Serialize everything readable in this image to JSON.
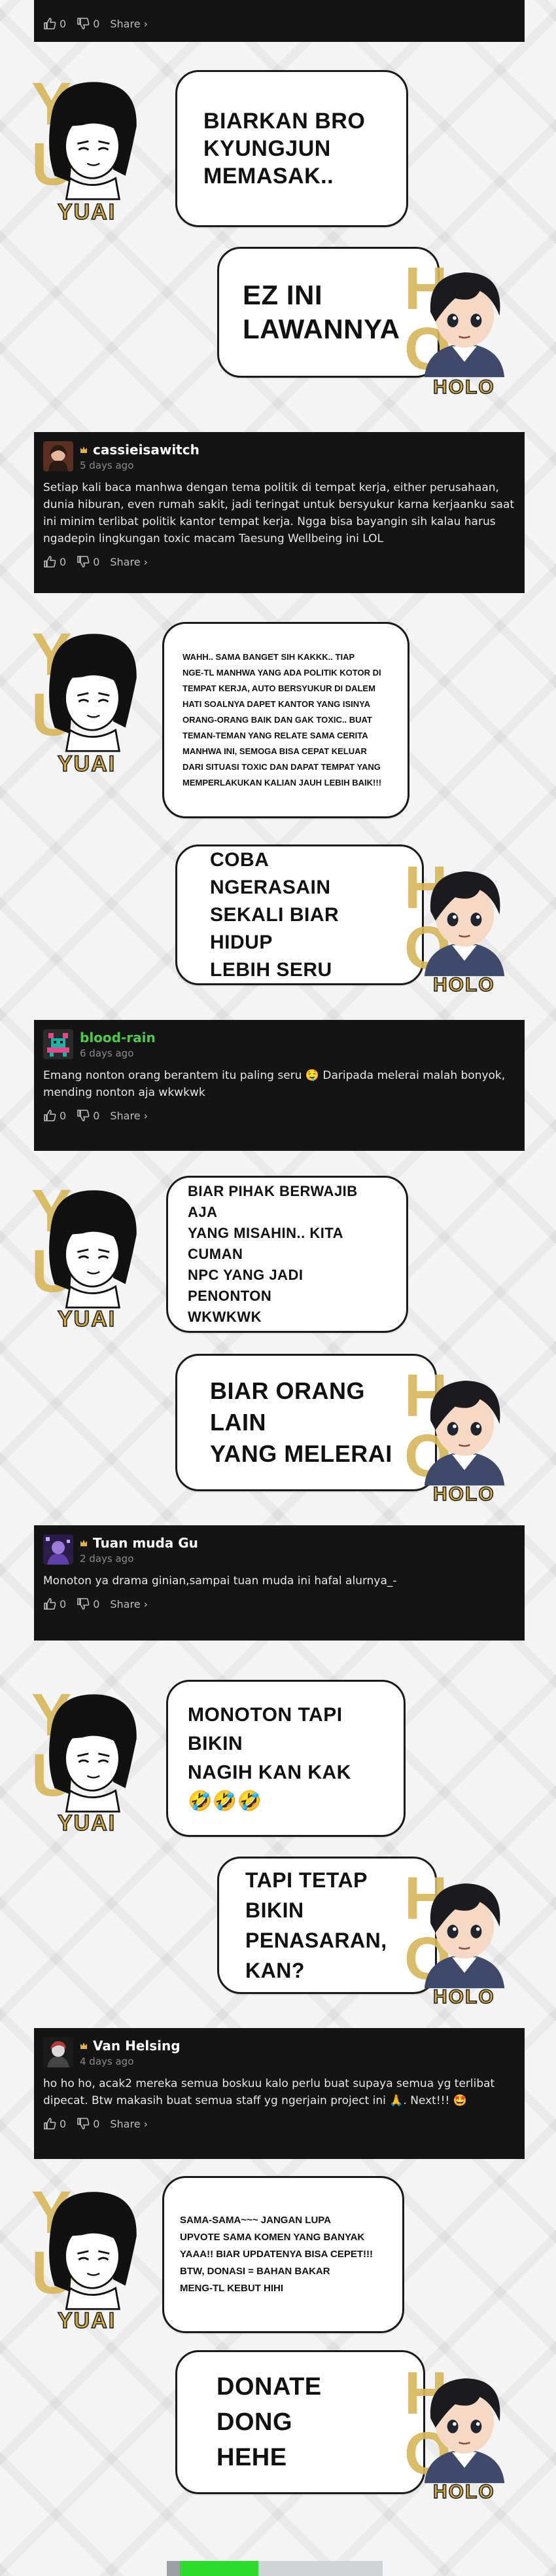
{
  "share_label": "Share ›",
  "colors": {
    "gold": "#d7b65a",
    "comment_bg": "#141414",
    "green_name": "#4ec94e"
  },
  "characters": {
    "yuai_logo": "YUAI",
    "holo_logo": "HOLO"
  },
  "top_comment": {
    "like_count": "0",
    "dislike_count": "0"
  },
  "panels": [
    {
      "yuai": "Biarkan bro\nKyungjun\nmemasak..",
      "holo": "EZ ini\nlawannya"
    },
    {
      "yuai": "Wahh.. sama banget sih kakkk.. tiap\nnge-tl manhwa yang ada politik kotor di\ntempat kerja, auto bersyukur di dalem\nhati soalnya dapet kantor yang isinya\norang-orang baik dan gak toxic.. buat\nteman-teman yang relate sama cerita\nmanhwa ini, semoga bisa cepat keluar\ndari situasi toxic dan dapat tempat yang\nmemperlakukan kalian jauh lebih baik!!!",
      "holo": "Coba ngerasain\nsekali biar hidup\nlebih seru"
    },
    {
      "yuai": "Biar pihak berwajib aja\nyang misahin.. kita cuman\nNPC yang jadi penonton\nwkwkwk",
      "holo": "Biar orang lain\nyang melerai"
    },
    {
      "yuai": "Monoton tapi bikin\nnagih kan kak\n🤣🤣🤣",
      "holo": "Tapi tetap bikin\npenasaran, kan?"
    },
    {
      "yuai": "Sama-sama~~~ jangan lupa\nupvote sama komen yang banyak\nyaaa!! biar updatenya bisa cepet!!!\nBTW, donasi = bahan bakar\nmeng-TL kebut hihi",
      "holo": "Donate dong\nhehe"
    }
  ],
  "comments": [
    {
      "username": "cassieisawitch",
      "badge_icon": "crown-icon",
      "time": "5 days ago",
      "body": "Setiap kali baca manhwa dengan tema politik di tempat kerja, either perusahaan, dunia hiburan, even rumah sakit, jadi teringat untuk bersyukur karna kerjaanku saat ini minim terlibat politik kantor tempat kerja. Ngga bisa bayangin sih kalau harus ngadepin lingkungan toxic macam Taesung Wellbeing ini LOL",
      "likes": "0",
      "dislikes": "0"
    },
    {
      "username": "blood-rain",
      "time": "6 days ago",
      "body": "Emang nonton orang berantem itu paling seru 🤤 Daripada melerai malah bonyok, mending nonton aja wkwkwk",
      "likes": "0",
      "dislikes": "0"
    },
    {
      "username": "Tuan muda Gu",
      "badge_icon": "crown-icon",
      "time": "2 days ago",
      "body": "Monoton ya drama ginian,sampai tuan muda ini hafal alurnya_-",
      "likes": "0",
      "dislikes": "0"
    },
    {
      "username": "Van Helsing",
      "badge_icon": "crown-icon",
      "time": "4 days ago",
      "body": "ho ho ho, acak2 mereka semua boskuu kalo perlu buat supaya semua yg terlibat dipecat. Btw makasih buat semua staff yg ngerjain project ini 🙏. Next!!! 🤩",
      "likes": "0",
      "dislikes": "0"
    }
  ]
}
